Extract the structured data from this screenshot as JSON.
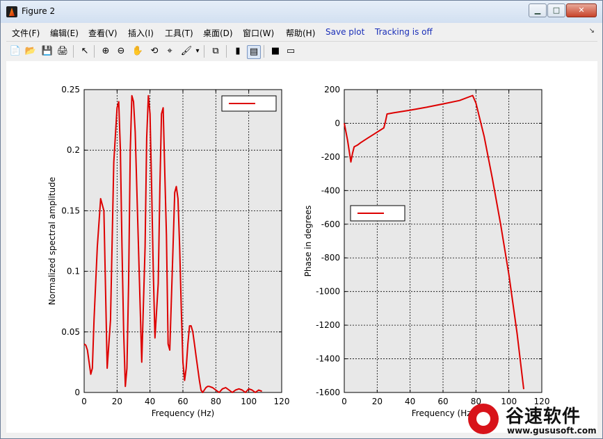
{
  "window": {
    "title": "Figure 2",
    "minimize": "▁",
    "maximize": "□",
    "close": "✕"
  },
  "menu": {
    "items": [
      "文件(F)",
      "编辑(E)",
      "查看(V)",
      "插入(I)",
      "工具(T)",
      "桌面(D)",
      "窗口(W)",
      "帮助(H)"
    ],
    "save_plot": "Save plot",
    "tracking": "Tracking is off",
    "dock_arrow": "↘"
  },
  "toolbar": {
    "icons": [
      "new-figure-icon",
      "open-file-icon",
      "save-icon",
      "print-icon",
      "pointer-icon",
      "zoom-in-icon",
      "zoom-out-icon",
      "pan-icon",
      "rotate-icon",
      "data-cursor-icon",
      "brush-icon",
      "brush-dropdown-icon",
      "link-icon",
      "colorbar-icon",
      "legend-icon",
      "hide-tools-icon",
      "show-tools-icon"
    ],
    "glyphs": [
      "📄",
      "📂",
      "💾",
      "🖨",
      "↖",
      "⊕",
      "⊖",
      "✋",
      "⟲",
      "⌖",
      "🖌",
      "▾",
      "⧉",
      "▮",
      "▤",
      "■",
      "▭"
    ]
  },
  "chart_data": [
    {
      "type": "line",
      "xlabel": "Frequency (Hz)",
      "ylabel": "Normalized spectral amplitude",
      "xlim": [
        0,
        120
      ],
      "ylim": [
        0,
        0.25
      ],
      "xticks": [
        "0",
        "20",
        "40",
        "60",
        "80",
        "100",
        "120"
      ],
      "yticks": [
        "0",
        "0.05",
        "0.1",
        "0.15",
        "0.2",
        "0.25"
      ],
      "grid": true,
      "legend_placement": "top-right",
      "line_color": "#dd0000",
      "x": [
        0,
        1,
        2,
        4,
        5,
        6,
        8,
        10,
        12,
        14,
        16,
        18,
        20,
        21,
        22,
        23,
        24,
        25,
        26,
        27,
        28,
        29,
        30,
        31,
        33,
        35,
        37,
        38,
        39,
        40,
        41,
        42,
        43,
        45,
        46,
        47,
        48,
        49,
        50,
        51,
        52,
        54,
        55,
        56,
        57,
        58,
        59,
        60,
        61,
        62,
        63,
        64,
        65,
        66,
        67,
        68,
        70,
        71,
        72,
        74,
        75,
        76,
        78,
        80,
        82,
        84,
        86,
        88,
        90,
        92,
        94,
        96,
        98,
        100,
        102,
        104,
        106,
        108
      ],
      "y": [
        0.04,
        0.039,
        0.035,
        0.015,
        0.02,
        0.06,
        0.12,
        0.16,
        0.15,
        0.02,
        0.06,
        0.19,
        0.235,
        0.24,
        0.2,
        0.12,
        0.05,
        0.005,
        0.02,
        0.09,
        0.2,
        0.245,
        0.24,
        0.215,
        0.12,
        0.025,
        0.12,
        0.21,
        0.245,
        0.23,
        0.17,
        0.1,
        0.045,
        0.09,
        0.17,
        0.23,
        0.235,
        0.18,
        0.13,
        0.04,
        0.035,
        0.12,
        0.165,
        0.17,
        0.16,
        0.12,
        0.07,
        0.025,
        0.01,
        0.02,
        0.04,
        0.055,
        0.055,
        0.05,
        0.04,
        0.03,
        0.01,
        0.002,
        0.0,
        0.004,
        0.005,
        0.005,
        0.004,
        0.002,
        0.0,
        0.003,
        0.004,
        0.002,
        0.0,
        0.002,
        0.003,
        0.002,
        0.0,
        0.003,
        0.002,
        0.0,
        0.002,
        0.001
      ]
    },
    {
      "type": "line",
      "xlabel": "Frequency (Hz)",
      "ylabel": "Phase in degrees",
      "xlim": [
        0,
        120
      ],
      "ylim": [
        -1600,
        200
      ],
      "xticks": [
        "0",
        "20",
        "40",
        "60",
        "80",
        "100",
        "120"
      ],
      "yticks": [
        "-1600",
        "-1400",
        "-1200",
        "-1000",
        "-800",
        "-600",
        "-400",
        "-200",
        "0",
        "200"
      ],
      "grid": true,
      "legend_placement": "middle-left",
      "line_color": "#dd0000",
      "x": [
        0,
        2,
        4,
        5,
        6,
        8,
        10,
        14,
        18,
        22,
        24,
        25,
        26,
        30,
        40,
        50,
        60,
        70,
        78,
        80,
        85,
        90,
        95,
        100,
        105,
        109
      ],
      "y": [
        0,
        -100,
        -230,
        -180,
        -140,
        -130,
        -115,
        -90,
        -65,
        -40,
        -28,
        10,
        55,
        62,
        78,
        95,
        115,
        135,
        165,
        120,
        -80,
        -330,
        -600,
        -900,
        -1250,
        -1580
      ]
    }
  ],
  "watermark": {
    "name": "谷速软件",
    "url": "www.gususoft.com"
  }
}
